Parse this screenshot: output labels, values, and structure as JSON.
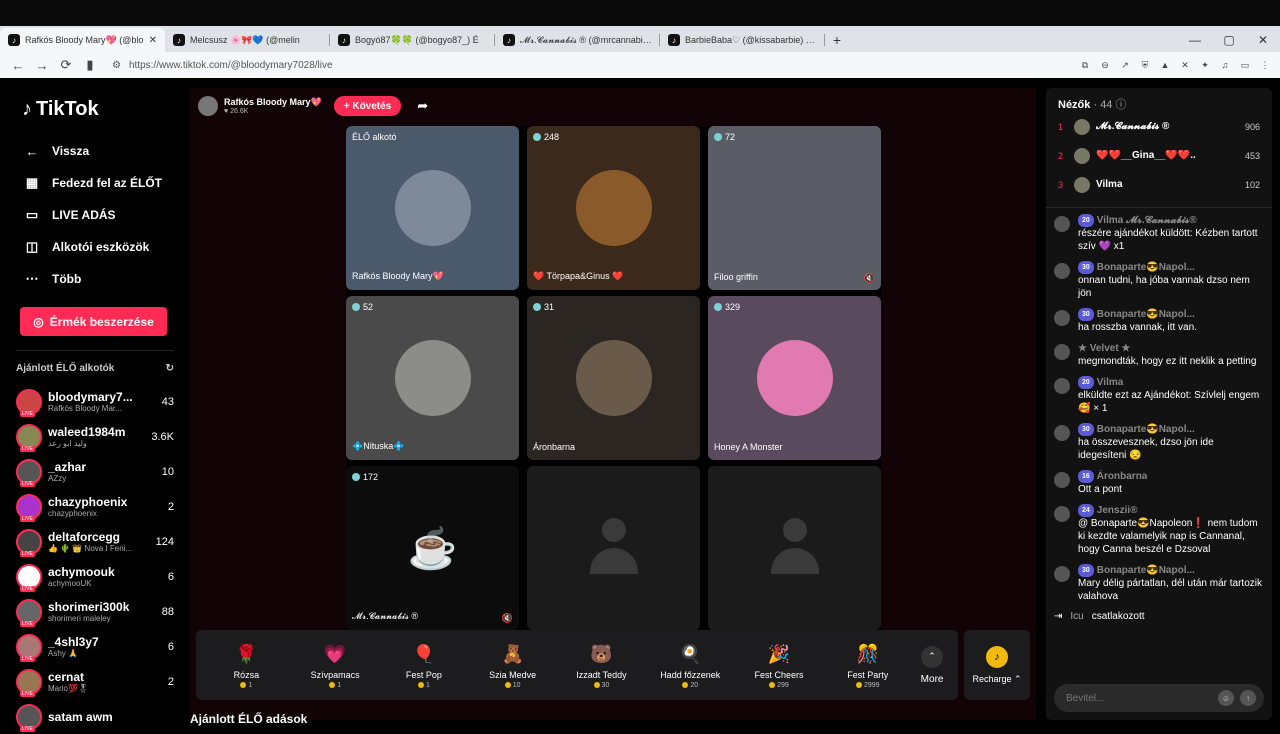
{
  "browser": {
    "tabs": [
      {
        "title": "Rafkós Bloody Mary💖 (@blo",
        "active": true
      },
      {
        "title": "Melcsusz 🌸🎀💙 (@melin",
        "active": false
      },
      {
        "title": "Bogyó87🍀🍀 (@bogyo87_) É",
        "active": false
      },
      {
        "title": "𝓜𝓻.𝓒𝓪𝓷𝓷𝓪𝓫𝓲𝓼 ® (@mrcannabis_)",
        "active": false
      },
      {
        "title": "BarbieBaba♡ (@kissabarbie) ÉLŐ",
        "active": false
      }
    ],
    "new_tab": "+",
    "url": "https://www.tiktok.com/@bloodymary7028/live"
  },
  "sidebar": {
    "logo": "TikTok",
    "back": "Vissza",
    "nav": [
      {
        "label": "Fedezd fel az ÉLŐT",
        "icon": "calendar-icon"
      },
      {
        "label": "LIVE ADÁS",
        "icon": "camera-icon"
      },
      {
        "label": "Alkotói eszközök",
        "icon": "tools-icon"
      },
      {
        "label": "Több",
        "icon": "more-icon"
      }
    ],
    "coins_button": "Érmék beszerzése",
    "recommended_title": "Ajánlott ÉLŐ alkotók",
    "recommended": [
      {
        "name": "bloodymary7...",
        "sub": "Rafkós Bloody Mar...",
        "count": "43",
        "color": "#c44"
      },
      {
        "name": "waleed1984m",
        "sub": "وليد ابو رعد",
        "count": "3.6K",
        "color": "#885"
      },
      {
        "name": "_azhar",
        "sub": "AZzy",
        "count": "10",
        "color": "#555"
      },
      {
        "name": "chazyphoenix",
        "sub": "chazyphoenix",
        "count": "2",
        "color": "#a3c"
      },
      {
        "name": "deltaforcegg",
        "sub": "👍 🌵 👑 Nova I Feni...",
        "count": "124",
        "color": "#444"
      },
      {
        "name": "achymoouk",
        "sub": "achymooUK",
        "count": "6",
        "color": "#fff"
      },
      {
        "name": "shorimeri300k",
        "sub": "shorimeri maleley",
        "count": "88",
        "color": "#666"
      },
      {
        "name": "_4shl3y7",
        "sub": "Ashy 🙏",
        "count": "6",
        "color": "#a77"
      },
      {
        "name": "cernat",
        "sub": "Mario💯🎖",
        "count": "2",
        "color": "#975"
      },
      {
        "name": "satam awm",
        "sub": "",
        "count": "",
        "color": "#555"
      }
    ]
  },
  "stream": {
    "host_name": "Rafkós Bloody Mary💖",
    "host_likes": "26.6K",
    "follow": "+ Követés",
    "cells": [
      {
        "badge": "ÉLŐ alkotó",
        "name": "Rafkós Bloody Mary💖",
        "bg": "#4b5a6a",
        "avatar": "#7e8a9a"
      },
      {
        "badge": "248",
        "name": "❤️ Törpapa&Ginus ❤️",
        "bg": "#3b2a1c",
        "avatar": "#8a5a2a"
      },
      {
        "badge": "72",
        "name": "Filoo griffin",
        "bg": "#5a5d66",
        "avatar": ""
      },
      {
        "badge": "52",
        "name": "💠Nituska💠",
        "bg": "#4a4a4a",
        "avatar": "#8c8c88"
      },
      {
        "badge": "31",
        "name": "Áronbarna",
        "bg": "#2b2622",
        "avatar": "#6a5a4a"
      },
      {
        "badge": "329",
        "name": "Honey A Monster",
        "bg": "#5a4a5e",
        "avatar": "#e07ab0"
      },
      {
        "badge": "172",
        "name": "𝓜𝓻.𝓒𝓪𝓷𝓷𝓪𝓫𝓲𝓼 ®",
        "bg": "#0c0c0c",
        "avatar": ""
      },
      {
        "badge": "",
        "name": "",
        "bg": "#1b1b1b",
        "avatar": ""
      },
      {
        "badge": "",
        "name": "",
        "bg": "#1b1b1b",
        "avatar": ""
      }
    ],
    "gifts": [
      {
        "label": "Rózsa",
        "price": "1",
        "icon": "🌹"
      },
      {
        "label": "Szívpamacs",
        "price": "1",
        "icon": "💗"
      },
      {
        "label": "Fest Pop",
        "price": "1",
        "icon": "🎈"
      },
      {
        "label": "Szia Medve",
        "price": "10",
        "icon": "🧸"
      },
      {
        "label": "Izzadt Teddy",
        "price": "30",
        "icon": "🐻"
      },
      {
        "label": "Hadd főzzenek",
        "price": "20",
        "icon": "🍳"
      },
      {
        "label": "Fest Cheers",
        "price": "299",
        "icon": "🎉"
      },
      {
        "label": "Fest Party",
        "price": "2999",
        "icon": "🎊"
      }
    ],
    "more": "More",
    "recharge": "Recharge ⌃",
    "section_title": "Ajánlott ÉLŐ adások"
  },
  "chat": {
    "viewers_title": "Nézők",
    "viewers_count": "· 44",
    "top": [
      {
        "rank": "1",
        "name": "𝓜𝓻.𝓒𝓪𝓷𝓷𝓪𝓫𝓲𝓼 ®",
        "score": "906"
      },
      {
        "rank": "2",
        "name": "❤️❤️__Gina__❤️❤️..",
        "score": "453"
      },
      {
        "rank": "3",
        "name": "Vilma",
        "score": "102"
      }
    ],
    "messages": [
      {
        "user": "Vilma 𝓜𝓻.𝓒𝓪𝓷𝓷𝓪𝓫𝓲𝓼®",
        "level": "20",
        "text": "részére ajándékot küldött: Kézben tartott szív 💜 x1"
      },
      {
        "user": "Bonaparte😎Napol...",
        "level": "30",
        "text": "onnan tudni, ha jóba vannak dzso nem jön"
      },
      {
        "user": "Bonaparte😎Napol...",
        "level": "30",
        "text": "ha rosszba vannak, itt van."
      },
      {
        "user": "★ Velvet ★",
        "level": "",
        "text": "megmondták, hogy ez itt neklik a petting"
      },
      {
        "user": "Vilma",
        "level": "20",
        "text": "elküldte ezt az Ajándékot: Szívlelj engem 🥰 × 1"
      },
      {
        "user": "Bonaparte😎Napol...",
        "level": "30",
        "text": "ha összevesznek, dzso jön ide idegesíteni 😒"
      },
      {
        "user": "Áronbarna",
        "level": "16",
        "text": "Ott a pont"
      },
      {
        "user": "Jenszii®",
        "level": "24",
        "text": "@ Bonaparte😎Napoleon❗ nem tudom ki kezdte valamelyik nap is Cannanal, hogy Canna beszél e Dzsoval"
      },
      {
        "user": "Bonaparte😎Napol...",
        "level": "30",
        "text": "Mary délig pártatlan, dél után már tartozik valahova"
      }
    ],
    "join_user": "Icu",
    "join_text": "csatlakozott",
    "input_placeholder": "Bevitel..."
  }
}
